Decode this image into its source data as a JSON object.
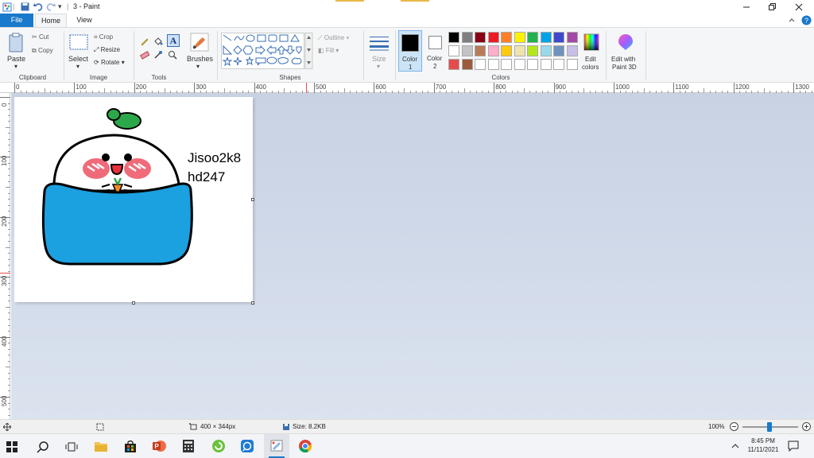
{
  "titlebar": {
    "title": "3 - Paint"
  },
  "tabs": [
    {
      "label": "File"
    },
    {
      "label": "Home"
    },
    {
      "label": "View"
    }
  ],
  "ribbon": {
    "clipboard": {
      "paste": "Paste",
      "cut": "Cut",
      "copy": "Copy",
      "group": "Clipboard"
    },
    "image": {
      "select": "Select",
      "crop": "Crop",
      "resize": "Resize",
      "rotate": "Rotate",
      "group": "Image"
    },
    "tools": {
      "group": "Tools"
    },
    "brushes": {
      "label": "Brushes"
    },
    "shapes": {
      "outline": "Outline",
      "fill": "Fill",
      "group": "Shapes"
    },
    "size": {
      "label": "Size"
    },
    "colors": {
      "color1": "Color\n1",
      "color1_a": "Color",
      "color1_b": "1",
      "color2_a": "Color",
      "color2_b": "2",
      "edit_a": "Edit",
      "edit_b": "colors",
      "paint3d_a": "Edit with",
      "paint3d_b": "Paint 3D",
      "group": "Colors",
      "palette_row1": [
        "#000000",
        "#7f7f7f",
        "#880015",
        "#ed1c24",
        "#ff7f27",
        "#fff200",
        "#22b14c",
        "#00a2e8",
        "#3f48cc",
        "#a349a4"
      ],
      "palette_row2": [
        "#ffffff",
        "#c3c3c3",
        "#b97a57",
        "#ffaec9",
        "#ffc90e",
        "#efe4b0",
        "#b5e61d",
        "#99d9ea",
        "#7092be",
        "#c8bfe7"
      ],
      "palette_row3": [
        "#e74c4c",
        "#9c5a3c",
        "#ffffff",
        "#ffffff",
        "#ffffff",
        "#ffffff",
        "#ffffff",
        "#ffffff",
        "#ffffff",
        "#ffffff"
      ]
    }
  },
  "ruler": {
    "h_ticks": [
      "0",
      "100",
      "200",
      "300",
      "400",
      "500",
      "600",
      "700",
      "800",
      "900",
      "1000",
      "1100",
      "1200",
      "1300"
    ],
    "v_ticks": [
      "0",
      "100",
      "200",
      "300",
      "400",
      "500"
    ]
  },
  "canvas": {
    "text_line1": "Jisoo2k8",
    "text_line2": "hd247"
  },
  "statusbar": {
    "dimensions": "400 × 344px",
    "size": "Size: 8.2KB",
    "zoom": "100%"
  },
  "taskbar": {
    "time": "8:45 PM",
    "date": "11/11/2021"
  }
}
